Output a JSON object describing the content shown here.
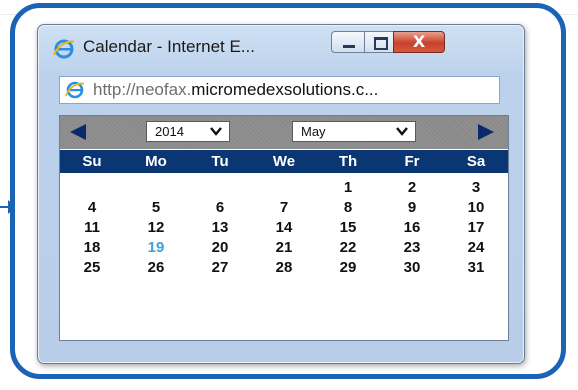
{
  "window": {
    "title": "Calendar - Internet E...",
    "controls": {
      "minimize": "minimize",
      "maximize": "maximize",
      "close": "X"
    }
  },
  "address_bar": {
    "url_prefix": "http://neofax.",
    "url_domain": "micromedexsolutions.c...",
    "icon": "ie-page-icon"
  },
  "calendar": {
    "year": "2014",
    "month": "May",
    "prev_icon": "left-arrow-icon",
    "next_icon": "right-arrow-icon",
    "weekdays": [
      "Su",
      "Mo",
      "Tu",
      "We",
      "Th",
      "Fr",
      "Sa"
    ],
    "weeks": [
      [
        "",
        "",
        "",
        "",
        "1",
        "2",
        "3"
      ],
      [
        "4",
        "5",
        "6",
        "7",
        "8",
        "9",
        "10"
      ],
      [
        "11",
        "12",
        "13",
        "14",
        "15",
        "16",
        "17"
      ],
      [
        "18",
        "19",
        "20",
        "21",
        "22",
        "23",
        "24"
      ],
      [
        "25",
        "26",
        "27",
        "28",
        "29",
        "30",
        "31"
      ]
    ],
    "today": "19",
    "colors": {
      "header": "#0a3773",
      "nav": "#8a8a8a",
      "today": "#3aa0e0",
      "callout_border": "#1b63b5"
    }
  }
}
